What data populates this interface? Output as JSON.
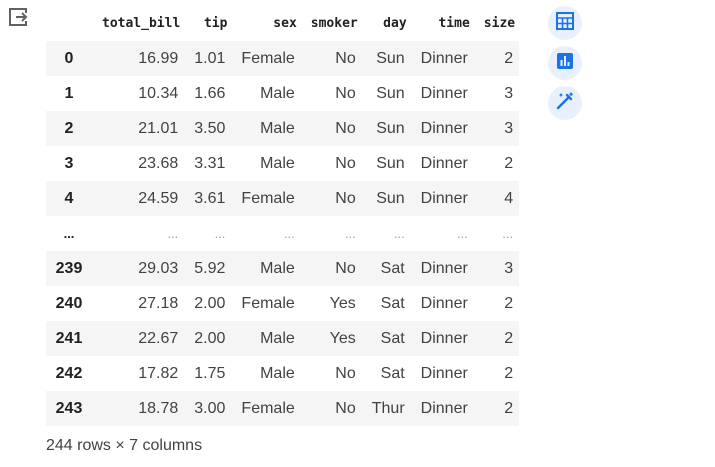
{
  "table": {
    "columns": [
      "",
      "total_bill",
      "tip",
      "sex",
      "smoker",
      "day",
      "time",
      "size"
    ],
    "rows": [
      [
        "0",
        "16.99",
        "1.01",
        "Female",
        "No",
        "Sun",
        "Dinner",
        "2"
      ],
      [
        "1",
        "10.34",
        "1.66",
        "Male",
        "No",
        "Sun",
        "Dinner",
        "3"
      ],
      [
        "2",
        "21.01",
        "3.50",
        "Male",
        "No",
        "Sun",
        "Dinner",
        "3"
      ],
      [
        "3",
        "23.68",
        "3.31",
        "Male",
        "No",
        "Sun",
        "Dinner",
        "2"
      ],
      [
        "4",
        "24.59",
        "3.61",
        "Female",
        "No",
        "Sun",
        "Dinner",
        "4"
      ],
      [
        "...",
        "...",
        "...",
        "...",
        "...",
        "...",
        "...",
        "..."
      ],
      [
        "239",
        "29.03",
        "5.92",
        "Male",
        "No",
        "Sat",
        "Dinner",
        "3"
      ],
      [
        "240",
        "27.18",
        "2.00",
        "Female",
        "Yes",
        "Sat",
        "Dinner",
        "2"
      ],
      [
        "241",
        "22.67",
        "2.00",
        "Male",
        "Yes",
        "Sat",
        "Dinner",
        "2"
      ],
      [
        "242",
        "17.82",
        "1.75",
        "Male",
        "No",
        "Sat",
        "Dinner",
        "2"
      ],
      [
        "243",
        "18.78",
        "3.00",
        "Female",
        "No",
        "Thur",
        "Dinner",
        "2"
      ]
    ]
  },
  "summary": "244 rows × 7 columns",
  "side_buttons": [
    {
      "icon": "table-icon"
    },
    {
      "icon": "bar-chart-icon"
    },
    {
      "icon": "magic-wand-icon"
    }
  ],
  "colors": {
    "accent": "#1a73e8",
    "button_bg": "#e8f0fe",
    "row_stripe": "#f5f5f5"
  }
}
